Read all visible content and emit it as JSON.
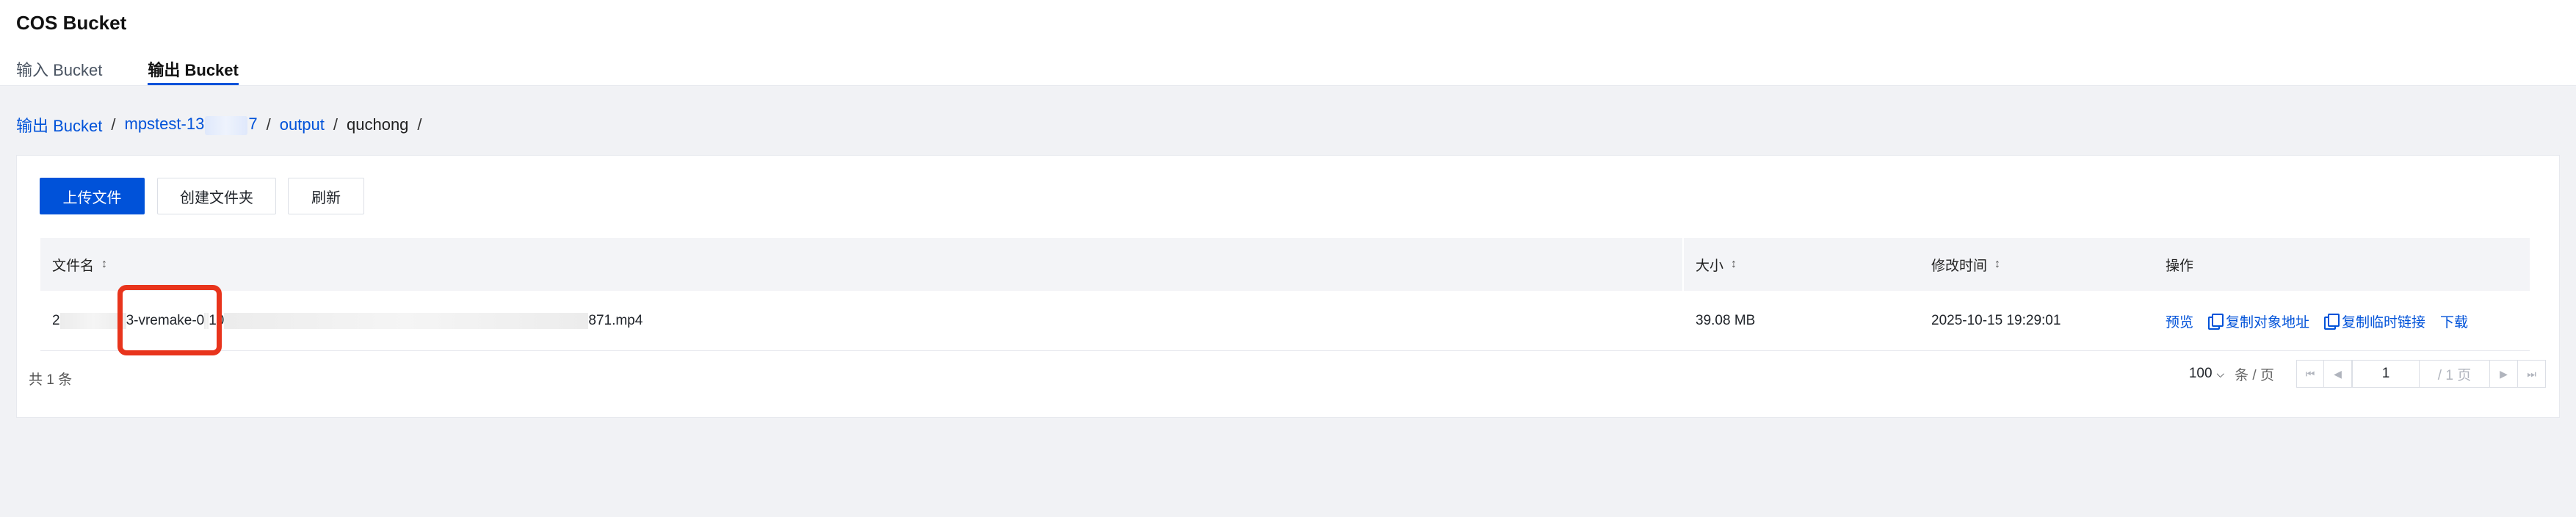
{
  "header": {
    "title": "COS Bucket",
    "tabs": [
      {
        "label": "输入 Bucket",
        "active": false
      },
      {
        "label": "输出 Bucket",
        "active": true
      }
    ]
  },
  "breadcrumb": {
    "items": [
      {
        "label": "输出 Bucket"
      },
      {
        "label_prefix": "mpstest-13",
        "label_suffix": "7"
      },
      {
        "label": "output"
      }
    ],
    "current": "quchong",
    "separator": "/"
  },
  "toolbar": {
    "upload_label": "上传文件",
    "create_folder_label": "创建文件夹",
    "refresh_label": "刷新"
  },
  "table": {
    "columns": [
      "文件名",
      "大小",
      "修改时间",
      "操作"
    ],
    "rows": [
      {
        "name_start": "2",
        "name_mid_a": "3-vremake-0",
        "name_mid_b": "10",
        "name_end": "871.mp4",
        "size": "39.08 MB",
        "modified": "2025-10-15 19:29:01",
        "actions": [
          "预览",
          "复制对象地址",
          "复制临时链接",
          "下载"
        ]
      }
    ]
  },
  "footer": {
    "total": "共 1 条",
    "page_size": "100",
    "page_size_unit": "条 / 页",
    "current_page": "1",
    "total_pages": "/ 1 页"
  },
  "colors": {
    "accent": "#0052d9",
    "highlight": "#e8341c"
  }
}
